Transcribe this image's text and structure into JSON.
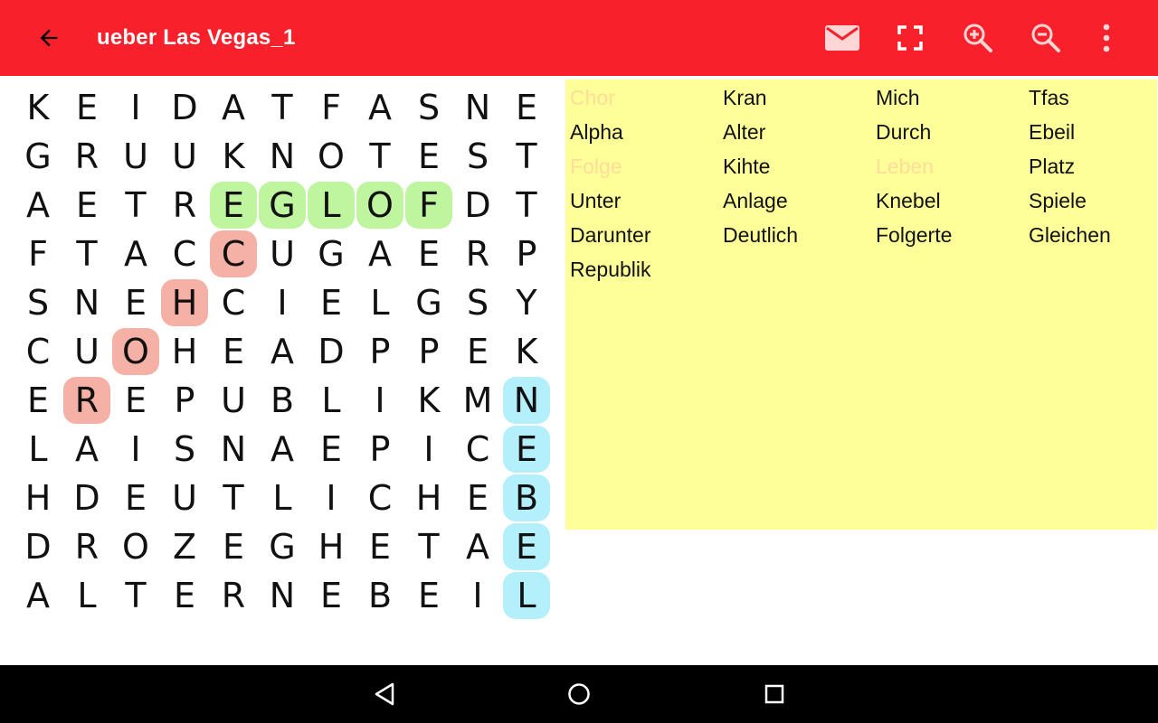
{
  "appbar": {
    "title": "ueber Las Vegas_1",
    "background_color": "#f8202b",
    "icons": [
      "arrow-back-icon",
      "mail-icon",
      "fullscreen-icon",
      "zoom-in-icon",
      "zoom-out-icon",
      "more-vert-icon"
    ]
  },
  "grid": {
    "rows": [
      "KEIDATFASNE",
      "GRUUKNOTEST",
      "AETREGLOFDT",
      "FTACCUGAERP",
      "SNEHCIELGSY",
      "CUOHEADPPEK",
      "EREPUBLIKMN",
      "LAISNAEPICE",
      "HDEUTLICHEB",
      "DROZEGHETAE",
      "ALTERNEBEIL"
    ],
    "highlight_colors": {
      "green": "#bff59e",
      "red": "#f6b1a6",
      "blue": "#b4effc"
    },
    "highlights": [
      {
        "color": "green",
        "cells": [
          [
            2,
            4
          ],
          [
            2,
            5
          ],
          [
            2,
            6
          ],
          [
            2,
            7
          ],
          [
            2,
            8
          ]
        ]
      },
      {
        "color": "red",
        "cells": [
          [
            3,
            4
          ],
          [
            4,
            3
          ],
          [
            5,
            2
          ],
          [
            6,
            1
          ]
        ]
      },
      {
        "color": "blue",
        "cells": [
          [
            6,
            10
          ],
          [
            7,
            10
          ],
          [
            8,
            10
          ],
          [
            9,
            10
          ],
          [
            10,
            10
          ]
        ]
      }
    ]
  },
  "word_list": {
    "background_color": "#ffff99",
    "found_color": "#ff9e9e",
    "columns": [
      [
        {
          "text": "Chor",
          "found": true
        },
        {
          "text": "Alpha",
          "found": false
        },
        {
          "text": "Folge",
          "found": true
        },
        {
          "text": "Unter",
          "found": false
        },
        {
          "text": "Darunter",
          "found": false
        },
        {
          "text": "Republik",
          "found": false
        }
      ],
      [
        {
          "text": "Kran",
          "found": false
        },
        {
          "text": "Alter",
          "found": false
        },
        {
          "text": "Kihte",
          "found": false
        },
        {
          "text": "Anlage",
          "found": false
        },
        {
          "text": "Deutlich",
          "found": false
        }
      ],
      [
        {
          "text": "Mich",
          "found": false
        },
        {
          "text": "Durch",
          "found": false
        },
        {
          "text": "Leben",
          "found": true
        },
        {
          "text": "Knebel",
          "found": false
        },
        {
          "text": "Folgerte",
          "found": false
        }
      ],
      [
        {
          "text": "Tfas",
          "found": false
        },
        {
          "text": "Ebeil",
          "found": false
        },
        {
          "text": "Platz",
          "found": false
        },
        {
          "text": "Spiele",
          "found": false
        },
        {
          "text": "Gleichen",
          "found": false
        }
      ]
    ]
  },
  "navbar": {
    "icons": [
      "nav-back-icon",
      "nav-home-icon",
      "nav-recents-icon"
    ]
  }
}
